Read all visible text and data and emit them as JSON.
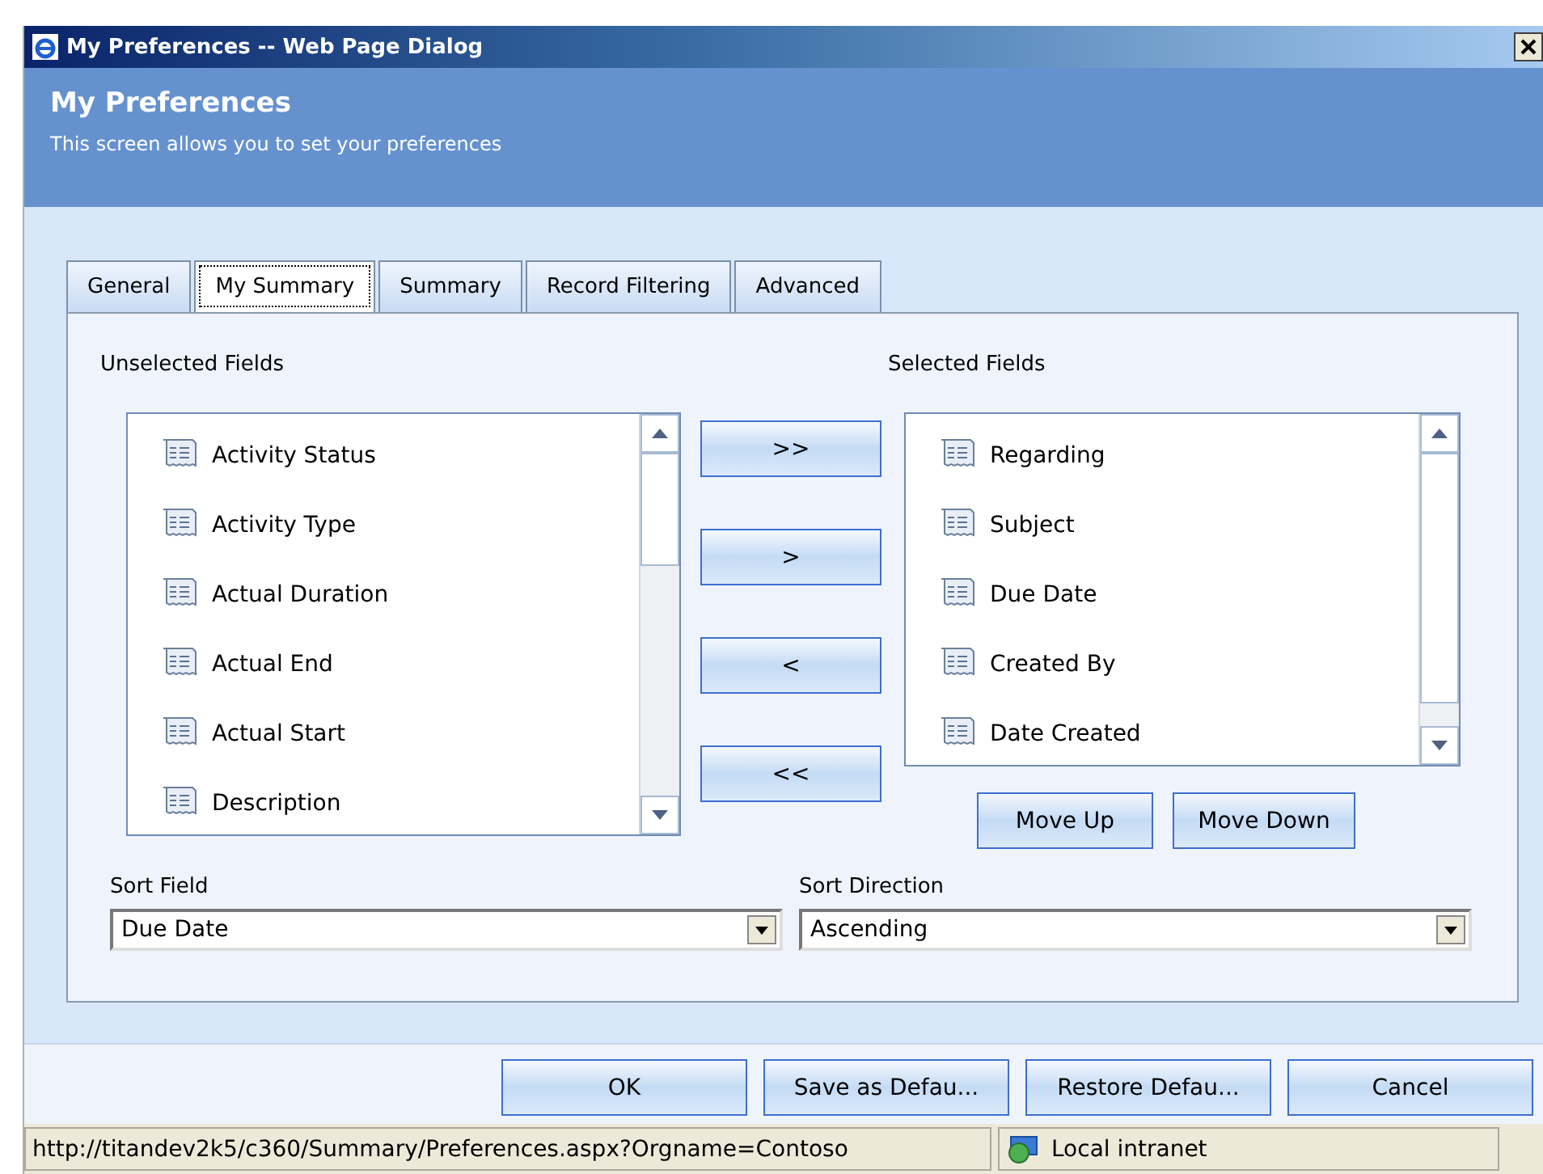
{
  "window": {
    "title": "My Preferences -- Web Page Dialog"
  },
  "header": {
    "title": "My Preferences",
    "subtitle": "This screen allows you to set your preferences"
  },
  "tabs": [
    {
      "label": "General",
      "selected": false
    },
    {
      "label": "My Summary",
      "selected": true
    },
    {
      "label": "Summary",
      "selected": false
    },
    {
      "label": "Record Filtering",
      "selected": false
    },
    {
      "label": "Advanced",
      "selected": false
    }
  ],
  "unselected_fields": {
    "label": "Unselected Fields",
    "items": [
      "Activity Status",
      "Activity Type",
      "Actual Duration",
      "Actual End",
      "Actual Start",
      "Description"
    ]
  },
  "transfer_buttons": [
    ">>",
    ">",
    "<",
    "<<"
  ],
  "selected_fields": {
    "label": "Selected Fields",
    "items": [
      "Regarding",
      "Subject",
      "Due Date",
      "Created By",
      "Date Created"
    ]
  },
  "order_buttons": [
    "Move Up",
    "Move Down"
  ],
  "sort_field": {
    "label": "Sort Field",
    "value": "Due Date"
  },
  "sort_direction": {
    "label": "Sort Direction",
    "value": "Ascending"
  },
  "footer_buttons": [
    "OK",
    "Save as Defau...",
    "Restore Defau...",
    "Cancel"
  ],
  "status_bar": {
    "url": "http://titandev2k5/c360/Summary/Preferences.aspx?Orgname=Contoso",
    "zone": "Local intranet"
  }
}
